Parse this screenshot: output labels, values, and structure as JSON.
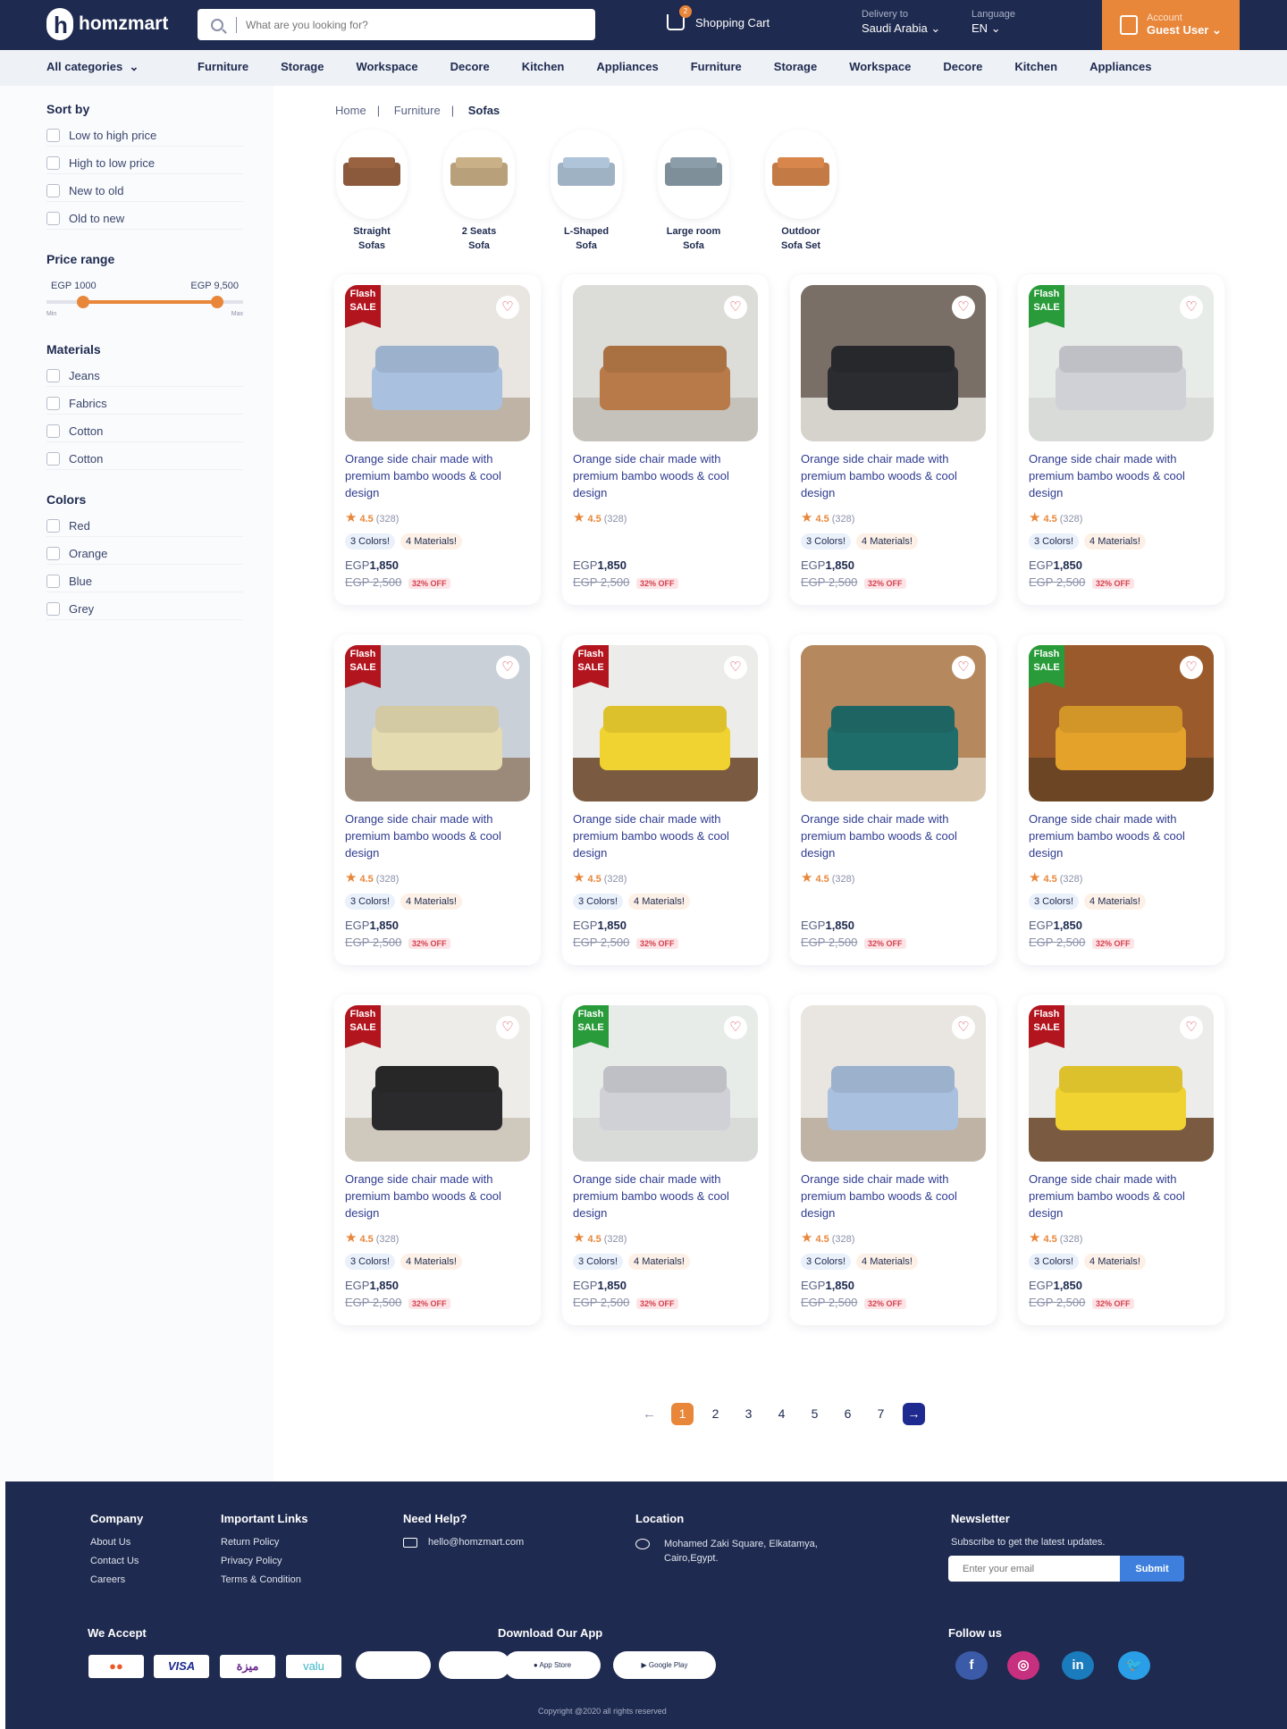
{
  "header": {
    "logo_text": "homzmart",
    "search_placeholder": "What are you looking for?",
    "cart_label": "Shopping Cart",
    "cart_count": "2",
    "delivery_label": "Delivery to",
    "delivery_value": "Saudi Arabia",
    "language_label": "Language",
    "language_value": "EN",
    "account_label": "Account",
    "account_value": "Guest User"
  },
  "categories": {
    "all_label": "All categories",
    "items": [
      "Furniture",
      "Storage",
      "Workspace",
      "Decore",
      "Kitchen",
      "Appliances",
      "Furniture",
      "Storage",
      "Workspace",
      "Decore",
      "Kitchen",
      "Appliances"
    ]
  },
  "sidebar": {
    "sort_title": "Sort by",
    "sort_options": [
      "Low to high price",
      "High to low price",
      "New to old",
      "Old to new"
    ],
    "price_title": "Price range",
    "price_min": "EGP 1000",
    "price_max": "EGP 9,500",
    "min_label": "Min",
    "max_label": "Max",
    "materials_title": "Materials",
    "materials": [
      "Jeans",
      "Fabrics",
      "Cotton",
      "Cotton"
    ],
    "colors_title": "Colors",
    "colors": [
      "Red",
      "Orange",
      "Blue",
      "Grey"
    ]
  },
  "breadcrumb": [
    "Home",
    "Furniture",
    "Sofas"
  ],
  "subcategories": [
    {
      "l1": "Straight",
      "l2": "Sofas",
      "color": "#8b5a3c"
    },
    {
      "l1": "2 Seats",
      "l2": "Sofa",
      "color": "#b8a07a"
    },
    {
      "l1": "L-Shaped",
      "l2": "Sofa",
      "color": "#9fb2c4"
    },
    {
      "l1": "Large room",
      "l2": "Sofa",
      "color": "#7e8f9a"
    },
    {
      "l1": "Outdoor",
      "l2": "Sofa Set",
      "color": "#c47a45"
    }
  ],
  "products": [
    {
      "flash": "red",
      "wall": "#e9e6e2",
      "floor": "#bfb3a5",
      "couch": "#a9c0de",
      "colors": true,
      "materials": true
    },
    {
      "flash": "",
      "wall": "#dcdcd8",
      "floor": "#c5c2bc",
      "couch": "#b87a48",
      "colors": false,
      "materials": false
    },
    {
      "flash": "",
      "wall": "#7a6f66",
      "floor": "#d6d3cd",
      "couch": "#2a2c30",
      "colors": true,
      "materials": true
    },
    {
      "flash": "green",
      "wall": "#e8ece9",
      "floor": "#d9dbd8",
      "couch": "#cfd1d6",
      "colors": true,
      "materials": true
    },
    {
      "flash": "red",
      "wall": "#c9d0d8",
      "floor": "#9b8a79",
      "couch": "#e5dbb1",
      "colors": true,
      "materials": true
    },
    {
      "flash": "red",
      "wall": "#ececea",
      "floor": "#7a5a40",
      "couch": "#f0d230",
      "colors": true,
      "materials": true
    },
    {
      "flash": "",
      "wall": "#b5885e",
      "floor": "#d8c7ae",
      "couch": "#1f6d6b",
      "colors": false,
      "materials": false
    },
    {
      "flash": "green",
      "wall": "#9a5a2c",
      "floor": "#6b4524",
      "couch": "#e4a22a",
      "colors": true,
      "materials": true
    },
    {
      "flash": "red",
      "wall": "#eeece8",
      "floor": "#cfc8bd",
      "couch": "#2a2a2c",
      "colors": true,
      "materials": true
    },
    {
      "flash": "green",
      "wall": "#e8ece9",
      "floor": "#d9dbd8",
      "couch": "#cfd1d6",
      "colors": true,
      "materials": true
    },
    {
      "flash": "",
      "wall": "#e9e6e2",
      "floor": "#bfb3a5",
      "couch": "#a9c0de",
      "colors": true,
      "materials": true
    },
    {
      "flash": "red",
      "wall": "#ececea",
      "floor": "#7a5a40",
      "couch": "#f0d230",
      "colors": true,
      "materials": true
    }
  ],
  "product_common": {
    "flash_l1": "Flash",
    "flash_l2": "SALE",
    "title": "Orange side chair made with premium bambo woods & cool design",
    "rating": "4.5",
    "reviews": "(328)",
    "colors_chip": "3 Colors!",
    "materials_chip": "4 Materials!",
    "currency": "EGP",
    "price": "1,850",
    "old_price": "EGP 2,500",
    "discount": "32% OFF"
  },
  "pagination": {
    "pages": [
      "1",
      "2",
      "3",
      "4",
      "5",
      "6",
      "7"
    ],
    "active": "1"
  },
  "footer": {
    "company_title": "Company",
    "company_links": [
      "About Us",
      "Contact Us",
      "Careers"
    ],
    "links_title": "Important Links",
    "links": [
      "Return Policy",
      "Privacy Policy",
      "Terms & Condition"
    ],
    "help_title": "Need Help?",
    "help_email": "hello@homzmart.com",
    "location_title": "Location",
    "location_l1": "Mohamed Zaki Square, Elkatamya,",
    "location_l2": "Cairo,Egypt.",
    "newsletter_title": "Newsletter",
    "newsletter_text": "Subscribe to get the latest updates.",
    "newsletter_placeholder": "Enter your email",
    "newsletter_button": "Submit",
    "accept_title": "We Accept",
    "app_title": "Download Our App",
    "follow_title": "Follow us",
    "app_store": "App Store",
    "google_play": "Google Play",
    "copyright": "Copyright @2020 all rights reserved"
  }
}
